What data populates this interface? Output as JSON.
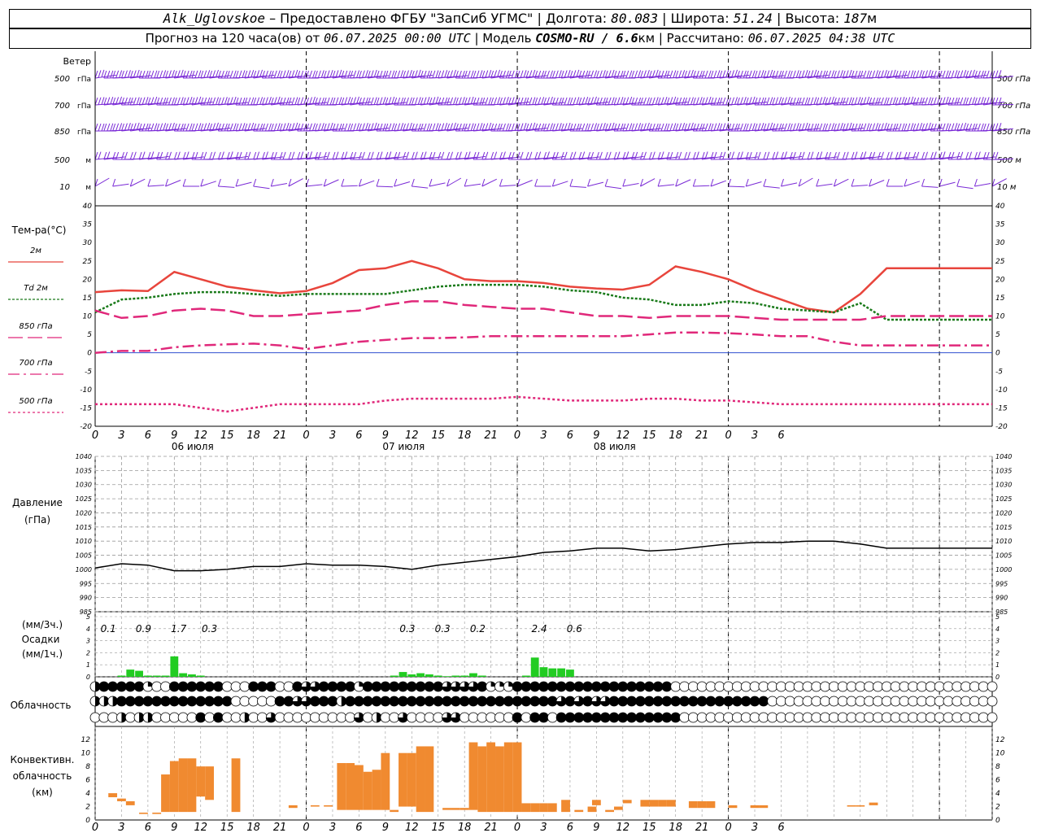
{
  "header": {
    "station": "Alk_Uglovskoe",
    "provided": "– Предоставлено ФГБУ \"ЗапСиб УГМС\"",
    "lon_label": "Долгота:",
    "lon": "80.083",
    "lat_label": "Широта:",
    "lat": "51.24",
    "alt_label": "Высота:",
    "alt": "187",
    "alt_unit": "м",
    "forecast_label": "Прогноз на 120 часа(ов) от",
    "forecast_start": "06.07.2025 00:00 UTC",
    "model_label": "Модель",
    "model": "COSMO-RU / 6.6",
    "model_unit": "км",
    "calc_label": "Рассчитано:",
    "calc_time": "06.07.2025 04:38 UTC"
  },
  "wind_panel": {
    "title": "Ветер",
    "levels": [
      "500 гПа",
      "700 гПа",
      "850 гПа",
      "500 м",
      "10 м"
    ]
  },
  "temp_panel": {
    "title": "Тем-ра(°C)",
    "legend": [
      "2м",
      "Td 2м",
      "850 гПа",
      "700 гПа",
      "500 гПа"
    ],
    "y_ticks": [
      "40",
      "35",
      "30",
      "25",
      "20",
      "15",
      "10",
      "5",
      "0",
      "-5",
      "-10",
      "-15",
      "-20"
    ]
  },
  "x_axis": {
    "hour_ticks": [
      "0",
      "3",
      "6",
      "9",
      "12",
      "15",
      "18",
      "21",
      "0",
      "3",
      "6",
      "9",
      "12",
      "15",
      "18",
      "21",
      "0",
      "3",
      "6",
      "9",
      "12",
      "15",
      "18",
      "21",
      "0",
      "3",
      "6"
    ],
    "days": [
      "06 июля",
      "07 июля",
      "08 июля"
    ]
  },
  "pressure_panel": {
    "title": "Давление",
    "unit": "(гПа)",
    "y_ticks": [
      "1040",
      "1035",
      "1030",
      "1025",
      "1020",
      "1015",
      "1010",
      "1005",
      "1000",
      "995",
      "990",
      "985"
    ]
  },
  "precip_panel": {
    "unit_3h": "(мм/3ч.)",
    "title": "Осадки",
    "unit_1h": "(мм/1ч.)",
    "y_ticks": [
      "5",
      "4",
      "3",
      "2",
      "1",
      "0"
    ],
    "totals": [
      {
        "hour": 1.5,
        "text": "0.1"
      },
      {
        "hour": 5.5,
        "text": "0.9"
      },
      {
        "hour": 9.5,
        "text": "1.7"
      },
      {
        "hour": 13,
        "text": "0.3"
      },
      {
        "hour": 35.5,
        "text": "0.3"
      },
      {
        "hour": 39.5,
        "text": "0.3"
      },
      {
        "hour": 43.5,
        "text": "0.2"
      },
      {
        "hour": 50.5,
        "text": "2.4"
      },
      {
        "hour": 54.5,
        "text": "0.6"
      }
    ]
  },
  "cloud_panel": {
    "title": "Облачность"
  },
  "conv_panel": {
    "title_line1": "Конвективн.",
    "title_line2": "облачность",
    "unit": "(км)",
    "y_ticks": [
      "12",
      "10",
      "8",
      "6",
      "4",
      "2",
      "0"
    ]
  },
  "colors": {
    "t2m": "#e8453c",
    "td2m": "#1a7a1a",
    "t850": "#e0287a",
    "t700": "#e0287a",
    "t500": "#e0287a",
    "wind": "#7a2ad6",
    "precip": "#22cc22",
    "conv": "#f08a30",
    "pressure": "#000000"
  },
  "chart_data": [
    {
      "type": "line",
      "name": "temperature",
      "ylabel": "Тем-ра(°C)",
      "ylim": [
        -20,
        40
      ],
      "x_hours": [
        0,
        3,
        6,
        9,
        12,
        15,
        18,
        21,
        24,
        27,
        30,
        33,
        36,
        39,
        42,
        45,
        48,
        51,
        54,
        57,
        60,
        63,
        66,
        69,
        72,
        75,
        78,
        81,
        84,
        87,
        90,
        93,
        96,
        99,
        102
      ],
      "series": [
        {
          "name": "2м",
          "values": [
            16.5,
            17,
            16.8,
            22,
            20,
            18,
            17,
            16.2,
            16.8,
            19,
            22.5,
            23,
            25,
            23,
            20,
            19.5,
            19.5,
            19,
            18,
            17.5,
            17.2,
            18.5,
            23.5,
            22,
            20,
            17,
            14.5,
            12,
            11,
            16,
            23,
            23,
            23,
            23,
            23
          ]
        },
        {
          "name": "Td 2м",
          "values": [
            11,
            14.5,
            15,
            16,
            16.5,
            16.5,
            16,
            15.5,
            16,
            16,
            16,
            16,
            17,
            18,
            18.5,
            18.5,
            18.5,
            18,
            17,
            16.5,
            15,
            14.5,
            13,
            13,
            14,
            13.5,
            12,
            11.5,
            11,
            13.5,
            9,
            9,
            9,
            9,
            9
          ]
        },
        {
          "name": "850 гПа",
          "values": [
            11.5,
            9.5,
            10,
            11.5,
            12,
            11.5,
            10,
            10,
            10.5,
            11,
            11.5,
            13,
            14,
            14,
            13,
            12.5,
            12,
            12,
            11,
            10,
            10,
            9.5,
            10,
            10,
            10,
            9.5,
            9,
            9,
            9,
            9,
            10,
            10,
            10,
            10,
            10
          ]
        },
        {
          "name": "700 гПа",
          "values": [
            0,
            0.5,
            0.5,
            1.5,
            2,
            2.3,
            2.5,
            2,
            1,
            2,
            3,
            3.5,
            4,
            4,
            4.2,
            4.5,
            4.5,
            4.5,
            4.5,
            4.5,
            4.5,
            5,
            5.5,
            5.5,
            5.3,
            5,
            4.5,
            4.5,
            3,
            2,
            2,
            2,
            2,
            2,
            2
          ]
        },
        {
          "name": "500 гПа",
          "values": [
            -14,
            -14,
            -14,
            -14,
            -15,
            -16,
            -15,
            -14,
            -14,
            -14,
            -14,
            -13,
            -12.5,
            -12.5,
            -12.5,
            -12.5,
            -12,
            -12.5,
            -13,
            -13,
            -13,
            -12.5,
            -12.5,
            -13,
            -13,
            -13.5,
            -14,
            -14,
            -14,
            -14,
            -14,
            -14,
            -14,
            -14,
            -14
          ]
        }
      ]
    },
    {
      "type": "line",
      "name": "pressure",
      "ylabel": "Давление (гПа)",
      "ylim": [
        985,
        1040
      ],
      "x_hours": [
        0,
        3,
        6,
        9,
        12,
        15,
        18,
        21,
        24,
        27,
        30,
        33,
        36,
        39,
        42,
        45,
        48,
        51,
        54,
        57,
        60,
        63,
        66,
        69,
        72,
        75,
        78,
        81,
        84,
        87,
        90,
        93,
        96,
        99,
        102
      ],
      "values": [
        1000.5,
        1002,
        1001.5,
        999.5,
        999.5,
        1000,
        1001,
        1001,
        1002,
        1001.5,
        1001.5,
        1001,
        1000,
        1001.5,
        1002.5,
        1003.5,
        1004.5,
        1006,
        1006.5,
        1007.5,
        1007.5,
        1006.5,
        1007,
        1008,
        1009,
        1009.5,
        1009.5,
        1010,
        1010,
        1009,
        1007.5,
        1007.5,
        1007.5,
        1007.5,
        1007.5
      ]
    },
    {
      "type": "bar",
      "name": "precipitation",
      "ylabel": "Осадки (мм/1ч.)",
      "ylim": [
        0,
        5
      ],
      "x_hours": [
        3,
        4,
        5,
        6,
        7,
        8,
        9,
        10,
        11,
        12,
        34,
        35,
        36,
        37,
        38,
        39,
        40,
        41,
        42,
        43,
        44,
        49,
        50,
        51,
        52,
        53,
        54
      ],
      "values": [
        0.1,
        0.6,
        0.5,
        0.1,
        0.1,
        0.1,
        1.7,
        0.3,
        0.2,
        0.1,
        0.1,
        0.4,
        0.2,
        0.3,
        0.2,
        0.1,
        0.05,
        0.1,
        0.1,
        0.3,
        0.1,
        0.1,
        1.6,
        0.8,
        0.7,
        0.7,
        0.6
      ]
    },
    {
      "type": "bar",
      "name": "convective_cloud",
      "ylabel": "Конвективн. облачность (км)",
      "ylim": [
        0,
        13
      ],
      "bars": [
        {
          "hour": 2,
          "bottom": 3.4,
          "top": 4
        },
        {
          "hour": 3,
          "bottom": 2.8,
          "top": 3.2
        },
        {
          "hour": 4,
          "bottom": 2.2,
          "top": 2.8
        },
        {
          "hour": 5.5,
          "bottom": 0.9,
          "top": 1.1
        },
        {
          "hour": 7,
          "bottom": 0.9,
          "top": 1.1
        },
        {
          "hour": 8,
          "bottom": 1.2,
          "top": 6.8
        },
        {
          "hour": 9,
          "bottom": 1.2,
          "top": 8.8
        },
        {
          "hour": 10,
          "bottom": 1.2,
          "top": 9.2
        },
        {
          "hour": 11,
          "bottom": 1.2,
          "top": 9.2
        },
        {
          "hour": 12,
          "bottom": 3.5,
          "top": 8
        },
        {
          "hour": 13,
          "bottom": 3,
          "top": 8
        },
        {
          "hour": 16,
          "bottom": 1.2,
          "top": 9.2
        },
        {
          "hour": 22.5,
          "bottom": 1.8,
          "top": 2.2
        },
        {
          "hour": 25,
          "bottom": 2,
          "top": 2.2
        },
        {
          "hour": 26.5,
          "bottom": 2,
          "top": 2.2
        },
        {
          "hour": 28,
          "bottom": 1.5,
          "top": 8.5
        },
        {
          "hour": 29,
          "bottom": 1.5,
          "top": 8.5
        },
        {
          "hour": 30,
          "bottom": 1.5,
          "top": 8.2
        },
        {
          "hour": 31,
          "bottom": 1.5,
          "top": 7.2
        },
        {
          "hour": 32,
          "bottom": 1.5,
          "top": 7.5
        },
        {
          "hour": 33,
          "bottom": 1.5,
          "top": 10
        },
        {
          "hour": 34,
          "bottom": 1.2,
          "top": 1.5
        },
        {
          "hour": 35,
          "bottom": 2,
          "top": 10
        },
        {
          "hour": 36,
          "bottom": 2,
          "top": 10
        },
        {
          "hour": 37,
          "bottom": 1.2,
          "top": 11
        },
        {
          "hour": 38,
          "bottom": 1.2,
          "top": 11
        },
        {
          "hour": 40,
          "bottom": 1.5,
          "top": 1.8
        },
        {
          "hour": 41,
          "bottom": 1.5,
          "top": 1.8
        },
        {
          "hour": 42,
          "bottom": 1.5,
          "top": 1.8
        },
        {
          "hour": 43,
          "bottom": 1.5,
          "top": 11.6
        },
        {
          "hour": 44,
          "bottom": 1.2,
          "top": 11
        },
        {
          "hour": 45,
          "bottom": 1.2,
          "top": 11.6
        },
        {
          "hour": 46,
          "bottom": 1.2,
          "top": 11
        },
        {
          "hour": 47,
          "bottom": 1.2,
          "top": 11.6
        },
        {
          "hour": 48,
          "bottom": 1.2,
          "top": 11.6
        },
        {
          "hour": 49,
          "bottom": 1.2,
          "top": 2.5
        },
        {
          "hour": 50,
          "bottom": 1.2,
          "top": 2.5
        },
        {
          "hour": 51,
          "bottom": 1.2,
          "top": 2.5
        },
        {
          "hour": 52,
          "bottom": 1.2,
          "top": 2.5
        },
        {
          "hour": 53.5,
          "bottom": 1.2,
          "top": 3
        },
        {
          "hour": 55,
          "bottom": 1.2,
          "top": 1.5
        },
        {
          "hour": 56.5,
          "bottom": 1.2,
          "top": 2
        },
        {
          "hour": 57,
          "bottom": 2.2,
          "top": 3
        },
        {
          "hour": 58.5,
          "bottom": 1.2,
          "top": 1.5
        },
        {
          "hour": 59.5,
          "bottom": 1.5,
          "top": 2
        },
        {
          "hour": 60.5,
          "bottom": 2.5,
          "top": 3
        },
        {
          "hour": 62.5,
          "bottom": 2,
          "top": 3
        },
        {
          "hour": 63.5,
          "bottom": 2,
          "top": 3
        },
        {
          "hour": 64.5,
          "bottom": 2,
          "top": 3
        },
        {
          "hour": 65.5,
          "bottom": 2,
          "top": 3
        },
        {
          "hour": 68,
          "bottom": 1.8,
          "top": 2.8
        },
        {
          "hour": 69,
          "bottom": 1.8,
          "top": 2.8
        },
        {
          "hour": 70,
          "bottom": 1.8,
          "top": 2.8
        },
        {
          "hour": 72.5,
          "bottom": 1.8,
          "top": 2.2
        },
        {
          "hour": 75,
          "bottom": 1.8,
          "top": 2.2
        },
        {
          "hour": 76,
          "bottom": 1.8,
          "top": 2.2
        },
        {
          "hour": 86,
          "bottom": 2,
          "top": 2.2
        },
        {
          "hour": 87,
          "bottom": 2,
          "top": 2.2
        },
        {
          "hour": 88.5,
          "bottom": 2.2,
          "top": 2.6
        }
      ]
    }
  ]
}
